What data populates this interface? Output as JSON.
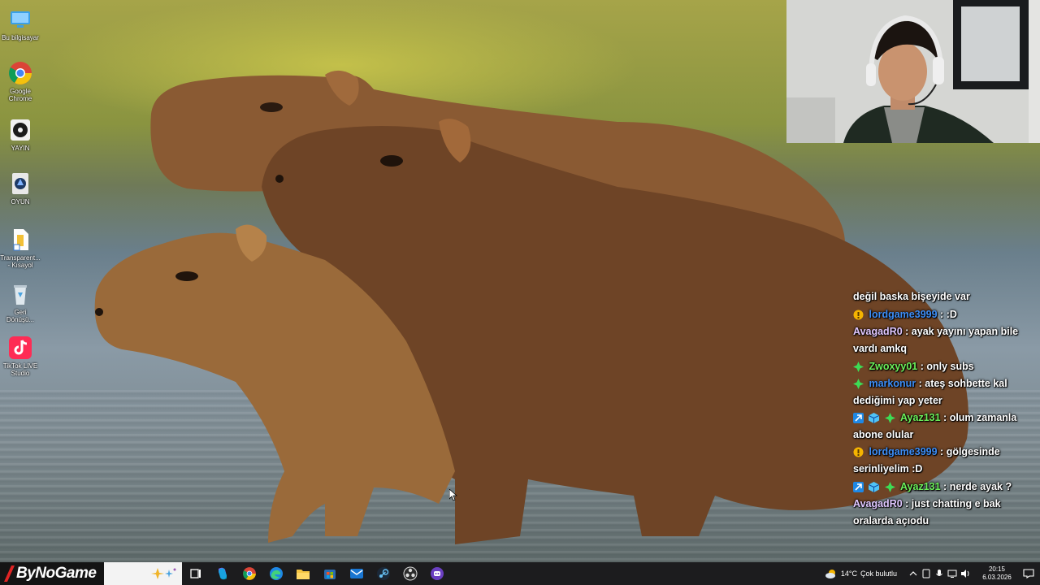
{
  "desktop": {
    "icons": [
      {
        "label": "Bu bilgisayar",
        "icon": "computer-icon"
      },
      {
        "label": "Google Chrome",
        "icon": "chrome-icon"
      },
      {
        "label": "YAYIN",
        "icon": "obs-icon"
      },
      {
        "label": "OYUN",
        "icon": "game-shortcut-icon"
      },
      {
        "label": "Transparent... - Kısayol",
        "icon": "file-shortcut-icon"
      },
      {
        "label": "Geri Dönüşü...",
        "icon": "recycle-bin-icon"
      },
      {
        "label": "TikTok LIVE Studio",
        "icon": "tiktok-icon"
      }
    ]
  },
  "chat": {
    "messages": [
      {
        "user": "",
        "user_color": "#ffffff",
        "badges": [],
        "text": "değil baska bişeyide var"
      },
      {
        "user": "lordgame3999",
        "user_color": "#3d8ef7",
        "badges": [
          "gold-coin-badge"
        ],
        "text": ":D"
      },
      {
        "user": "AvagadR0",
        "user_color": "#e0c7ff",
        "badges": [],
        "text": "ayak yayını yapan bile vardı amkq"
      },
      {
        "user": "Zwoxyy01",
        "user_color": "#6cf05a",
        "badges": [
          "green-gem-badge"
        ],
        "text": "only subs"
      },
      {
        "user": "markonur",
        "user_color": "#3d8ef7",
        "badges": [
          "green-gem-badge"
        ],
        "text": "ateş sohbette kal dediğimi yap yeter"
      },
      {
        "user": "Ayaz131",
        "user_color": "#6cf05a",
        "badges": [
          "blue-arrow-badge",
          "blue-cube-badge",
          "green-gem-badge"
        ],
        "text": "olum zamanla abone olular"
      },
      {
        "user": "lordgame3999",
        "user_color": "#3d8ef7",
        "badges": [
          "gold-coin-badge"
        ],
        "text": "gölgesinde serinliyelim :D"
      },
      {
        "user": "Ayaz131",
        "user_color": "#6cf05a",
        "badges": [
          "blue-arrow-badge",
          "blue-cube-badge",
          "green-gem-badge"
        ],
        "text": "nerde ayak ?"
      },
      {
        "user": "AvagadR0",
        "user_color": "#e0c7ff",
        "badges": [],
        "text": "just chatting e bak oralarda açıodu"
      }
    ]
  },
  "taskbar": {
    "brand": "ByNoGame",
    "pinned": [
      "task-view-icon",
      "copilot-icon",
      "chrome-icon",
      "edge-icon",
      "file-explorer-icon",
      "store-icon",
      "mail-icon",
      "steam-icon",
      "obs-icon",
      "streaming-app-icon"
    ],
    "weather_temp": "14°C",
    "weather_desc": "Çok bulutlu",
    "time": "20:15",
    "date": "6.03.2026"
  },
  "colors": {
    "taskbar_bg": "#1c1c1e",
    "chat_blue": "#3d8ef7",
    "chat_green": "#6cf05a"
  }
}
